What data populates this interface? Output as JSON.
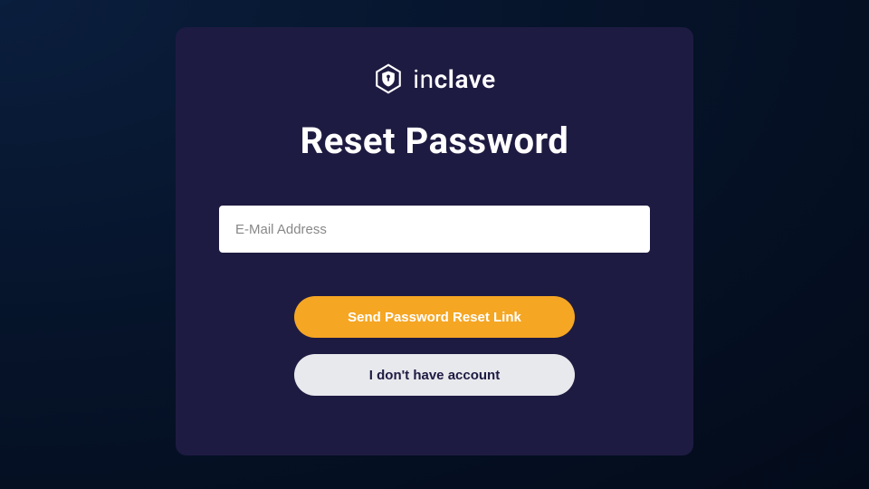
{
  "brand": {
    "name_prefix": "in",
    "name_suffix": "clave"
  },
  "title": "Reset Password",
  "form": {
    "email_placeholder": "E-Mail Address",
    "submit_label": "Send Password Reset Link",
    "no_account_label": "I don't have account"
  }
}
